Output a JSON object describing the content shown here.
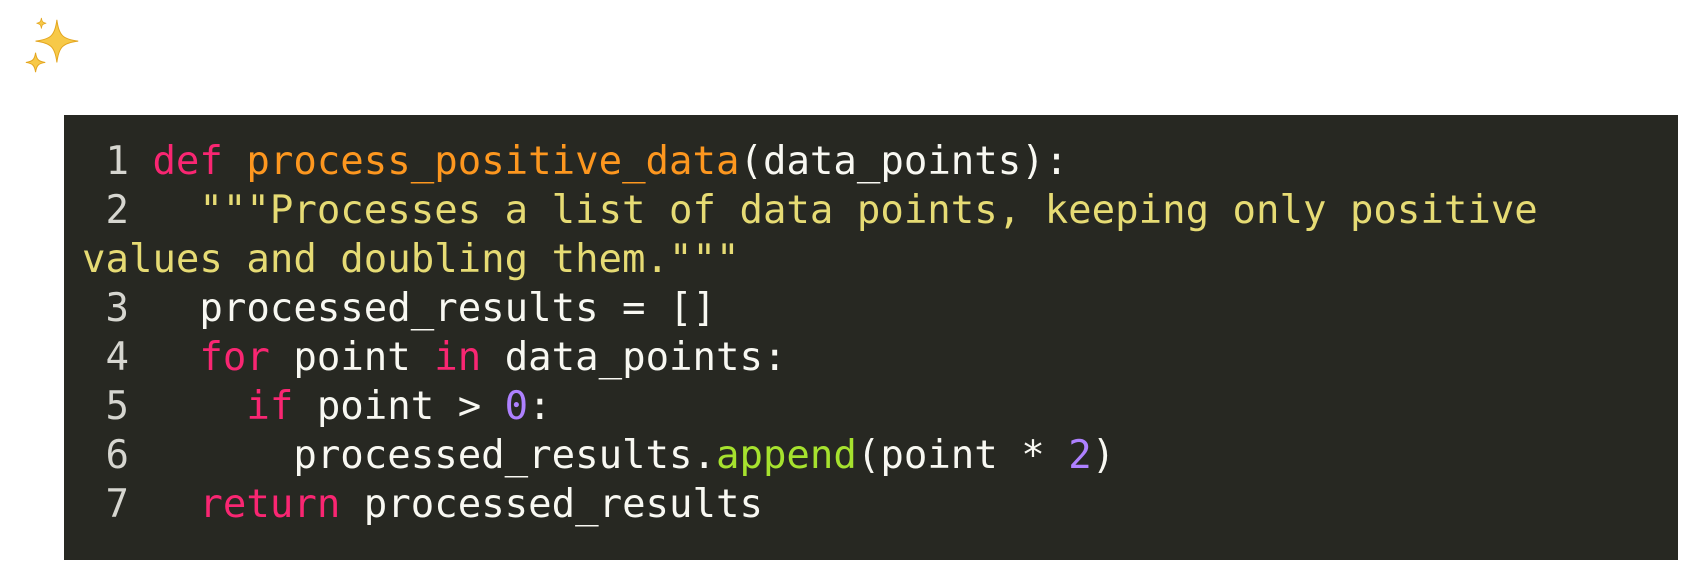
{
  "icon": "sparkles-icon",
  "colors": {
    "background": "#ffffff",
    "code_background": "#272822",
    "keyword": "#f92672",
    "function_name": "#fd971f",
    "string": "#e6db74",
    "number": "#ae81ff",
    "method": "#a6e22e",
    "text": "#f8f8f2"
  },
  "code": {
    "lines": [
      {
        "number": "1",
        "tokens": [
          {
            "kind": "kw",
            "text": "def"
          },
          {
            "kind": "plain",
            "text": " "
          },
          {
            "kind": "fn",
            "text": "process_positive_data"
          },
          {
            "kind": "plain",
            "text": "(data_points):"
          }
        ]
      },
      {
        "number": "2",
        "tokens": [
          {
            "kind": "plain",
            "text": "  "
          },
          {
            "kind": "str",
            "text": "\"\"\"Processes a list of data points, keeping only positive values and doubling them.\"\"\""
          }
        ]
      },
      {
        "number": "3",
        "tokens": [
          {
            "kind": "plain",
            "text": "  processed_results = []"
          }
        ]
      },
      {
        "number": "4",
        "tokens": [
          {
            "kind": "plain",
            "text": "  "
          },
          {
            "kind": "kw",
            "text": "for"
          },
          {
            "kind": "plain",
            "text": " point "
          },
          {
            "kind": "kw",
            "text": "in"
          },
          {
            "kind": "plain",
            "text": " data_points:"
          }
        ]
      },
      {
        "number": "5",
        "tokens": [
          {
            "kind": "plain",
            "text": "    "
          },
          {
            "kind": "kw",
            "text": "if"
          },
          {
            "kind": "plain",
            "text": " point > "
          },
          {
            "kind": "num",
            "text": "0"
          },
          {
            "kind": "plain",
            "text": ":"
          }
        ]
      },
      {
        "number": "6",
        "tokens": [
          {
            "kind": "plain",
            "text": "      processed_results."
          },
          {
            "kind": "call",
            "text": "append"
          },
          {
            "kind": "plain",
            "text": "(point * "
          },
          {
            "kind": "num",
            "text": "2"
          },
          {
            "kind": "plain",
            "text": ")"
          }
        ]
      },
      {
        "number": "7",
        "tokens": [
          {
            "kind": "plain",
            "text": "  "
          },
          {
            "kind": "kw",
            "text": "return"
          },
          {
            "kind": "plain",
            "text": " processed_results"
          }
        ]
      }
    ]
  }
}
